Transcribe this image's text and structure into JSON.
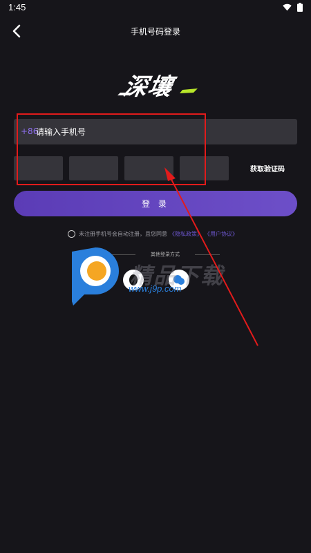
{
  "status_bar": {
    "time": "1:45"
  },
  "header": {
    "title": "手机号码登录"
  },
  "logo": {
    "text": "深壤"
  },
  "phone": {
    "country_code": "+86",
    "placeholder": "请输入手机号"
  },
  "code": {
    "get_code_label": "获取验证码",
    "box_count": 4
  },
  "login_button": {
    "label": "登 录"
  },
  "agreement": {
    "text": "未注册手机号会自动注册，且您同意",
    "privacy_link": "《隐私政策》",
    "user_link": "《用户协议》"
  },
  "other_login": {
    "label": "其他登录方式"
  },
  "watermark": {
    "text": "精品下载",
    "url": "www.j9p.com"
  },
  "colors": {
    "background": "#16151a",
    "input_bg": "#35343a",
    "accent": "#6a55c9",
    "annotation": "#e21b1b"
  }
}
